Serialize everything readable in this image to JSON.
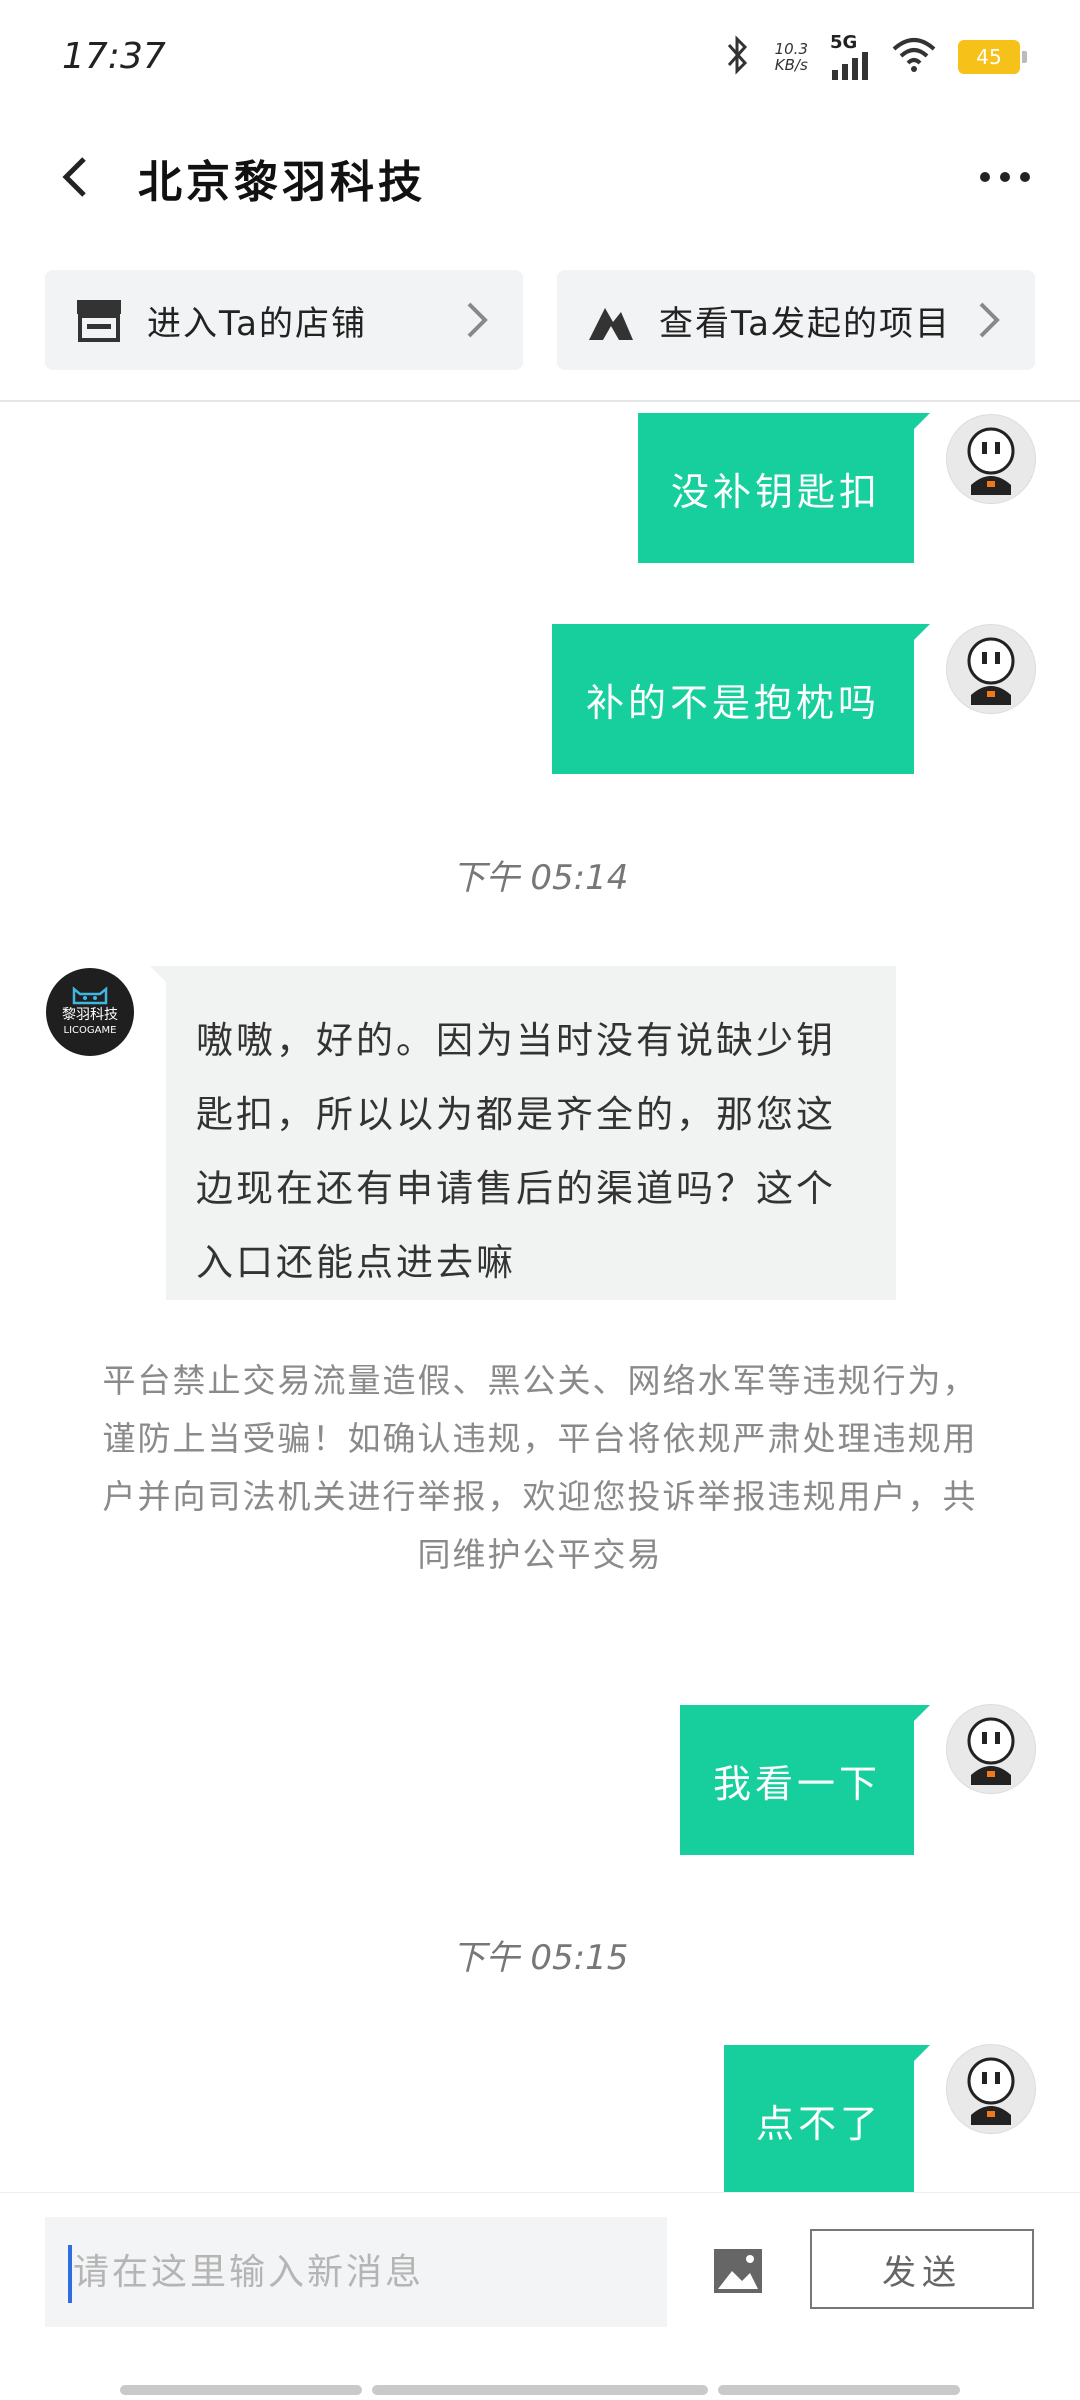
{
  "status_bar": {
    "time": "17:37",
    "net_speed_value": "10.3",
    "net_speed_unit": "KB/s",
    "network": "5G",
    "battery": "45",
    "icons": [
      "bluetooth-icon",
      "signal-icon",
      "wifi-icon",
      "battery-icon"
    ]
  },
  "header": {
    "title": "北京黎羽科技",
    "back_icon": "chevron-left-icon",
    "more_icon": "more-dots-icon"
  },
  "shortcuts": [
    {
      "label": "进入Ta的店铺",
      "icon": "store-icon"
    },
    {
      "label": "查看Ta发起的项目",
      "icon": "mountain-icon"
    }
  ],
  "messages": {
    "m1": "没补钥匙扣",
    "m2": "补的不是抱枕吗",
    "time1": "下午 05:14",
    "shop_reply": "嗷嗷，好的。因为当时没有说缺少钥匙扣，所以以为都是齐全的，那您这边现在还有申请售后的渠道吗？这个入口还能点进去嘛",
    "shop_avatar_line1": "黎羽科技",
    "shop_avatar_line2": "LICOGAME",
    "notice": "平台禁止交易流量造假、黑公关、网络水军等违规行为，谨防上当受骗！如确认违规，平台将依规严肃处理违规用户并向司法机关进行举报，欢迎您投诉举报违规用户，共同维护公平交易",
    "m3": "我看一下",
    "time2": "下午 05:15",
    "m4": "点不了"
  },
  "input_bar": {
    "placeholder": "请在这里输入新消息",
    "send_label": "发送",
    "image_icon": "image-icon"
  },
  "colors": {
    "accent": "#17cf9d",
    "incoming_bubble": "#f1f2f2",
    "battery": "#f6c21a"
  }
}
